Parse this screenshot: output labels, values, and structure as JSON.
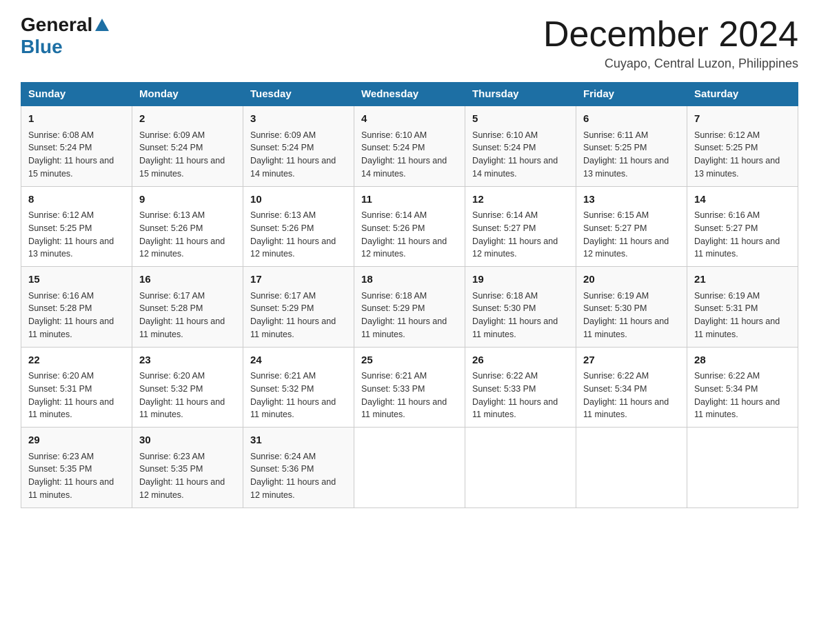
{
  "header": {
    "logo_general": "General",
    "logo_blue": "Blue",
    "month_title": "December 2024",
    "location": "Cuyapo, Central Luzon, Philippines"
  },
  "days_of_week": [
    "Sunday",
    "Monday",
    "Tuesday",
    "Wednesday",
    "Thursday",
    "Friday",
    "Saturday"
  ],
  "weeks": [
    [
      {
        "day": "1",
        "sunrise": "6:08 AM",
        "sunset": "5:24 PM",
        "daylight": "11 hours and 15 minutes."
      },
      {
        "day": "2",
        "sunrise": "6:09 AM",
        "sunset": "5:24 PM",
        "daylight": "11 hours and 15 minutes."
      },
      {
        "day": "3",
        "sunrise": "6:09 AM",
        "sunset": "5:24 PM",
        "daylight": "11 hours and 14 minutes."
      },
      {
        "day": "4",
        "sunrise": "6:10 AM",
        "sunset": "5:24 PM",
        "daylight": "11 hours and 14 minutes."
      },
      {
        "day": "5",
        "sunrise": "6:10 AM",
        "sunset": "5:24 PM",
        "daylight": "11 hours and 14 minutes."
      },
      {
        "day": "6",
        "sunrise": "6:11 AM",
        "sunset": "5:25 PM",
        "daylight": "11 hours and 13 minutes."
      },
      {
        "day": "7",
        "sunrise": "6:12 AM",
        "sunset": "5:25 PM",
        "daylight": "11 hours and 13 minutes."
      }
    ],
    [
      {
        "day": "8",
        "sunrise": "6:12 AM",
        "sunset": "5:25 PM",
        "daylight": "11 hours and 13 minutes."
      },
      {
        "day": "9",
        "sunrise": "6:13 AM",
        "sunset": "5:26 PM",
        "daylight": "11 hours and 12 minutes."
      },
      {
        "day": "10",
        "sunrise": "6:13 AM",
        "sunset": "5:26 PM",
        "daylight": "11 hours and 12 minutes."
      },
      {
        "day": "11",
        "sunrise": "6:14 AM",
        "sunset": "5:26 PM",
        "daylight": "11 hours and 12 minutes."
      },
      {
        "day": "12",
        "sunrise": "6:14 AM",
        "sunset": "5:27 PM",
        "daylight": "11 hours and 12 minutes."
      },
      {
        "day": "13",
        "sunrise": "6:15 AM",
        "sunset": "5:27 PM",
        "daylight": "11 hours and 12 minutes."
      },
      {
        "day": "14",
        "sunrise": "6:16 AM",
        "sunset": "5:27 PM",
        "daylight": "11 hours and 11 minutes."
      }
    ],
    [
      {
        "day": "15",
        "sunrise": "6:16 AM",
        "sunset": "5:28 PM",
        "daylight": "11 hours and 11 minutes."
      },
      {
        "day": "16",
        "sunrise": "6:17 AM",
        "sunset": "5:28 PM",
        "daylight": "11 hours and 11 minutes."
      },
      {
        "day": "17",
        "sunrise": "6:17 AM",
        "sunset": "5:29 PM",
        "daylight": "11 hours and 11 minutes."
      },
      {
        "day": "18",
        "sunrise": "6:18 AM",
        "sunset": "5:29 PM",
        "daylight": "11 hours and 11 minutes."
      },
      {
        "day": "19",
        "sunrise": "6:18 AM",
        "sunset": "5:30 PM",
        "daylight": "11 hours and 11 minutes."
      },
      {
        "day": "20",
        "sunrise": "6:19 AM",
        "sunset": "5:30 PM",
        "daylight": "11 hours and 11 minutes."
      },
      {
        "day": "21",
        "sunrise": "6:19 AM",
        "sunset": "5:31 PM",
        "daylight": "11 hours and 11 minutes."
      }
    ],
    [
      {
        "day": "22",
        "sunrise": "6:20 AM",
        "sunset": "5:31 PM",
        "daylight": "11 hours and 11 minutes."
      },
      {
        "day": "23",
        "sunrise": "6:20 AM",
        "sunset": "5:32 PM",
        "daylight": "11 hours and 11 minutes."
      },
      {
        "day": "24",
        "sunrise": "6:21 AM",
        "sunset": "5:32 PM",
        "daylight": "11 hours and 11 minutes."
      },
      {
        "day": "25",
        "sunrise": "6:21 AM",
        "sunset": "5:33 PM",
        "daylight": "11 hours and 11 minutes."
      },
      {
        "day": "26",
        "sunrise": "6:22 AM",
        "sunset": "5:33 PM",
        "daylight": "11 hours and 11 minutes."
      },
      {
        "day": "27",
        "sunrise": "6:22 AM",
        "sunset": "5:34 PM",
        "daylight": "11 hours and 11 minutes."
      },
      {
        "day": "28",
        "sunrise": "6:22 AM",
        "sunset": "5:34 PM",
        "daylight": "11 hours and 11 minutes."
      }
    ],
    [
      {
        "day": "29",
        "sunrise": "6:23 AM",
        "sunset": "5:35 PM",
        "daylight": "11 hours and 11 minutes."
      },
      {
        "day": "30",
        "sunrise": "6:23 AM",
        "sunset": "5:35 PM",
        "daylight": "11 hours and 12 minutes."
      },
      {
        "day": "31",
        "sunrise": "6:24 AM",
        "sunset": "5:36 PM",
        "daylight": "11 hours and 12 minutes."
      },
      null,
      null,
      null,
      null
    ]
  ]
}
